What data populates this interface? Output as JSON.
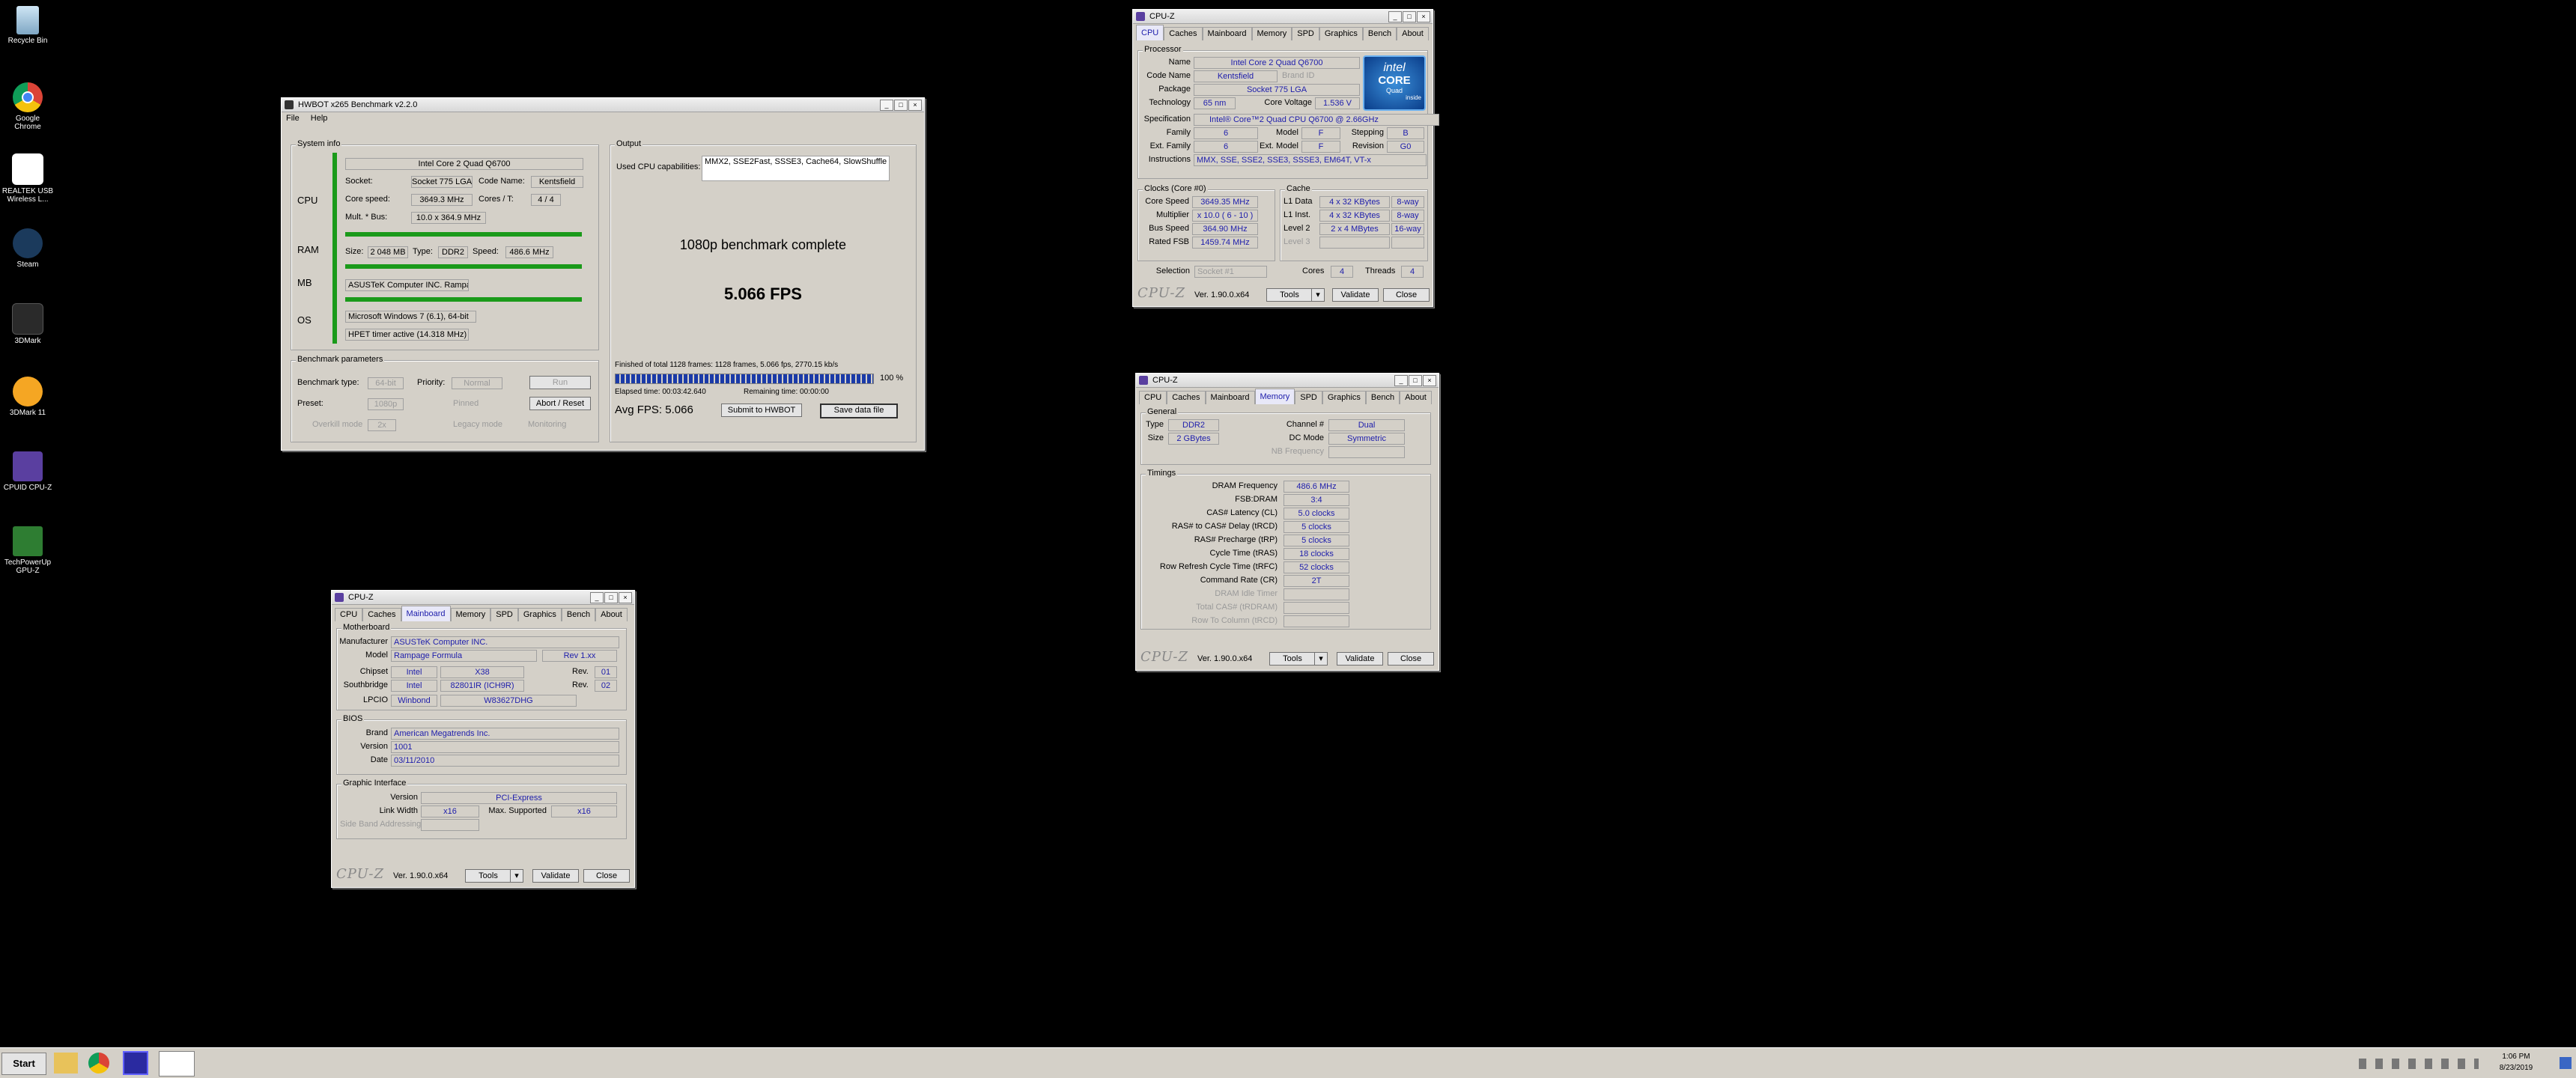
{
  "desktop": {
    "icons": [
      "Recycle Bin",
      "Google Chrome",
      "REALTEK USB Wireless L...",
      "Steam",
      "3DMark",
      "3DMark 11",
      "CPUID CPU-Z",
      "TechPowerUp GPU-Z"
    ]
  },
  "hwbot": {
    "title": "HWBOT x265 Benchmark v2.2.0",
    "menu": [
      "File",
      "Help"
    ],
    "sysinfo_label": "System info",
    "cpu_label": "CPU",
    "ram_label": "RAM",
    "mb_label": "MB",
    "os_label": "OS",
    "cpu_name": "Intel Core 2 Quad Q6700",
    "socket_label": "Socket:",
    "socket": "Socket 775 LGA",
    "codename_label": "Code Name:",
    "codename": "Kentsfield",
    "corespeed_label": "Core speed:",
    "corespeed": "3649.3 MHz",
    "cores_label": "Cores / T:",
    "cores": "4 / 4",
    "mult_label": "Mult. * Bus:",
    "mult": "10.0 x 364.9 MHz",
    "size_label": "Size:",
    "size": "2 048 MB",
    "type_label": "Type:",
    "type": "DDR2",
    "speed_label": "Speed:",
    "speed": "486.6 MHz",
    "mb": "ASUSTeK Computer INC. Rampage Formula",
    "os": "Microsoft Windows 7 (6.1), 64-bit",
    "timer": "HPET timer active (14.318 MHz)",
    "params_label": "Benchmark parameters",
    "btype_label": "Benchmark type:",
    "btype": "64-bit",
    "priority_label": "Priority:",
    "priority": "Normal",
    "run": "Run",
    "preset_label": "Preset:",
    "preset": "1080p",
    "pinned": "Pinned",
    "abort": "Abort / Reset",
    "overkill": "Overkill mode",
    "overkill_val": "2x",
    "legacy": "Legacy mode",
    "monitoring": "Monitoring",
    "output_label": "Output",
    "capabilities_label": "Used CPU capabilities:",
    "capabilities": "MMX2, SSE2Fast, SSSE3, Cache64, SlowShuffle",
    "complete": "1080p benchmark complete",
    "fps": "5.066 FPS",
    "finished": "Finished of total 1128 frames: 1128 frames, 5.066 fps,  2770.15 kb/s",
    "progress_pct": "100 %",
    "elapsed": "Elapsed time: 00:03:42.640",
    "remaining": "Remaining time: 00:00:00",
    "avgfps": "Avg FPS: 5.066",
    "submit": "Submit to HWBOT",
    "save": "Save data file"
  },
  "cpuz_common": {
    "title": "CPU-Z",
    "tabs": [
      "CPU",
      "Caches",
      "Mainboard",
      "Memory",
      "SPD",
      "Graphics",
      "Bench",
      "About"
    ],
    "logo": "CPU-Z",
    "version": "Ver. 1.90.0.x64",
    "tools": "Tools",
    "validate": "Validate",
    "close": "Close"
  },
  "cpuz_cpu": {
    "processor_label": "Processor",
    "name_label": "Name",
    "name": "Intel Core 2 Quad Q6700",
    "codename_label": "Code Name",
    "codename": "Kentsfield",
    "brandid_label": "Brand ID",
    "package_label": "Package",
    "package": "Socket 775 LGA",
    "tech_label": "Technology",
    "tech": "65 nm",
    "voltage_label": "Core Voltage",
    "voltage": "1.536 V",
    "spec_label": "Specification",
    "spec": "Intel® Core™2 Quad CPU    Q6700  @ 2.66GHz",
    "family_label": "Family",
    "family": "6",
    "model_label": "Model",
    "model": "F",
    "stepping_label": "Stepping",
    "stepping": "B",
    "extfamily_label": "Ext. Family",
    "extfamily": "6",
    "extmodel_label": "Ext. Model",
    "extmodel": "F",
    "revision_label": "Revision",
    "revision": "G0",
    "instr_label": "Instructions",
    "instr": "MMX, SSE, SSE2, SSE3, SSSE3, EM64T, VT-x",
    "clocks_label": "Clocks (Core #0)",
    "corespeed_label": "Core Speed",
    "corespeed": "3649.35 MHz",
    "multiplier_label": "Multiplier",
    "multiplier": "x 10.0 ( 6 - 10 )",
    "busspeed_label": "Bus Speed",
    "busspeed": "364.90 MHz",
    "ratedfsb_label": "Rated FSB",
    "ratedfsb": "1459.74 MHz",
    "cache_label": "Cache",
    "l1data_label": "L1 Data",
    "l1data": "4 x 32 KBytes",
    "l1data_way": "8-way",
    "l1inst_label": "L1 Inst.",
    "l1inst": "4 x 32 KBytes",
    "l1inst_way": "8-way",
    "level2_label": "Level 2",
    "level2": "2 x 4 MBytes",
    "level2_way": "16-way",
    "level3_label": "Level 3",
    "selection_label": "Selection",
    "selection": "Socket #1",
    "cores_label": "Cores",
    "cores": "4",
    "threads_label": "Threads",
    "threads": "4",
    "intel_logo_top": "intel",
    "intel_logo_mid": "CORE",
    "intel_logo_sub": "Quad",
    "intel_logo_inside": "inside"
  },
  "cpuz_mem": {
    "general_label": "General",
    "type_label": "Type",
    "type": "DDR2",
    "channel_label": "Channel #",
    "channel": "Dual",
    "size_label": "Size",
    "size": "2 GBytes",
    "dcmode_label": "DC Mode",
    "dcmode": "Symmetric",
    "nbfreq_label": "NB Frequency",
    "timings_label": "Timings",
    "rows": [
      {
        "label": "DRAM Frequency",
        "value": "486.6 MHz",
        "dim": false
      },
      {
        "label": "FSB:DRAM",
        "value": "3:4",
        "dim": false
      },
      {
        "label": "CAS# Latency (CL)",
        "value": "5.0 clocks",
        "dim": false
      },
      {
        "label": "RAS# to CAS# Delay (tRCD)",
        "value": "5 clocks",
        "dim": false
      },
      {
        "label": "RAS# Precharge (tRP)",
        "value": "5 clocks",
        "dim": false
      },
      {
        "label": "Cycle Time (tRAS)",
        "value": "18 clocks",
        "dim": false
      },
      {
        "label": "Row Refresh Cycle Time (tRFC)",
        "value": "52 clocks",
        "dim": false
      },
      {
        "label": "Command Rate (CR)",
        "value": "2T",
        "dim": false
      },
      {
        "label": "DRAM Idle Timer",
        "value": "",
        "dim": true
      },
      {
        "label": "Total CAS# (tRDRAM)",
        "value": "",
        "dim": true
      },
      {
        "label": "Row To Column (tRCD)",
        "value": "",
        "dim": true
      }
    ]
  },
  "cpuz_mb": {
    "motherboard_label": "Motherboard",
    "manufacturer_label": "Manufacturer",
    "manufacturer": "ASUSTeK Computer INC.",
    "model_label": "Model",
    "model": "Rampage Formula",
    "model_rev": "Rev 1.xx",
    "chipset_label": "Chipset",
    "chipset_vendor": "Intel",
    "chipset": "X38",
    "rev_label": "Rev.",
    "chipset_rev": "01",
    "southbridge_label": "Southbridge",
    "sb_vendor": "Intel",
    "sb": "82801IR (ICH9R)",
    "sb_rev": "02",
    "lpcio_label": "LPCIO",
    "lpcio_vendor": "Winbond",
    "lpcio": "W83627DHG",
    "bios_label": "BIOS",
    "brand_label": "Brand",
    "brand": "American Megatrends Inc.",
    "version_label": "Version",
    "version": "1001",
    "date_label": "Date",
    "date": "03/11/2010",
    "gi_label": "Graphic Interface",
    "giversion_label": "Version",
    "giversion": "PCI-Express",
    "linkwidth_label": "Link Width",
    "linkwidth": "x16",
    "maxsup_label": "Max. Supported",
    "maxsup": "x16",
    "sideband_label": "Side Band Addressing"
  },
  "taskbar": {
    "start": "Start",
    "time": "1:06 PM",
    "date": "8/23/2019"
  }
}
